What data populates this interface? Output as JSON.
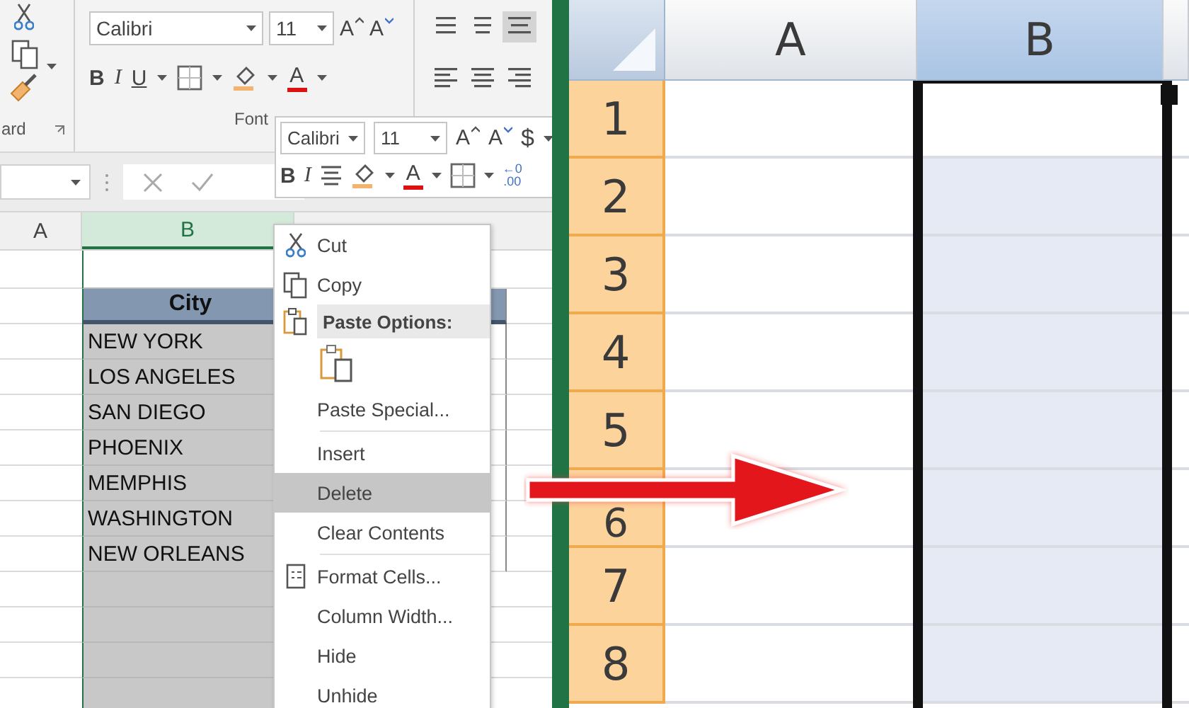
{
  "left_window": {
    "ribbon": {
      "clipboard_label": "ard",
      "font_name": "Calibri",
      "font_size": "11",
      "grow_font": "A",
      "shrink_font": "A",
      "bold": "B",
      "italic": "I",
      "underline": "U",
      "font_color": "A",
      "font_group_label": "Font",
      "align_buttons": [
        {
          "selected": false
        },
        {
          "selected": false
        },
        {
          "selected": true
        },
        {
          "selected": false
        },
        {
          "selected": false
        },
        {
          "selected": false
        }
      ]
    },
    "mini_toolbar": {
      "font_name": "Calibri",
      "font_size": "11",
      "grow_font": "A",
      "shrink_font": "A",
      "currency": "$",
      "bold": "B",
      "italic": "I",
      "font_color": "A",
      "decimal_top": "←0",
      "decimal_bottom": ".00"
    },
    "columns": [
      {
        "label": "A",
        "selected": false
      },
      {
        "label": "B",
        "selected": true
      }
    ],
    "table_header": "City",
    "cities": [
      "NEW YORK",
      "LOS ANGELES",
      "SAN DIEGO",
      "PHOENIX",
      "MEMPHIS",
      "WASHINGTON",
      "NEW ORLEANS"
    ],
    "context_menu": {
      "top_items": [
        {
          "label": "Cut",
          "selected": false
        },
        {
          "label": "Copy",
          "selected": false
        }
      ],
      "paste_header": "Paste Options:",
      "items": [
        {
          "label": "Paste Special...",
          "selected": false,
          "divider_after": true
        },
        {
          "label": "Insert",
          "selected": false,
          "divider_after": false
        },
        {
          "label": "Delete",
          "selected": true,
          "divider_after": false
        },
        {
          "label": "Clear Contents",
          "selected": false,
          "divider_after": true
        },
        {
          "label": "Format Cells...",
          "selected": false,
          "divider_after": false
        },
        {
          "label": "Column Width...",
          "selected": false,
          "divider_after": false
        },
        {
          "label": "Hide",
          "selected": false,
          "divider_after": false
        },
        {
          "label": "Unhide",
          "selected": false,
          "divider_after": false
        }
      ]
    }
  },
  "right_window": {
    "columns": [
      {
        "label": "A",
        "selected": false
      },
      {
        "label": "B",
        "selected": true
      }
    ],
    "rows": [
      "1",
      "2",
      "3",
      "4",
      "5",
      "6",
      "7",
      "8"
    ]
  }
}
